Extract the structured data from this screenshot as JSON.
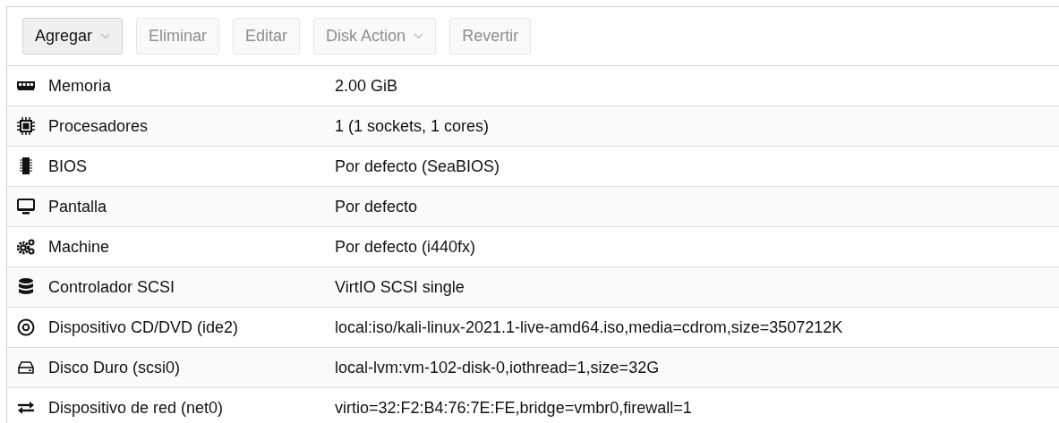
{
  "toolbar": {
    "buttons": [
      {
        "label": "Agregar",
        "disabled": false,
        "dropdown": true
      },
      {
        "label": "Eliminar",
        "disabled": true,
        "dropdown": false
      },
      {
        "label": "Editar",
        "disabled": true,
        "dropdown": false
      },
      {
        "label": "Disk Action",
        "disabled": true,
        "dropdown": true
      },
      {
        "label": "Revertir",
        "disabled": true,
        "dropdown": false
      }
    ]
  },
  "hardware": {
    "rows": [
      {
        "kind": "memory",
        "name": "Memoria",
        "value": "2.00 GiB"
      },
      {
        "kind": "cpu",
        "name": "Procesadores",
        "value": "1 (1 sockets, 1 cores)"
      },
      {
        "kind": "chip",
        "name": "BIOS",
        "value": "Por defecto (SeaBIOS)"
      },
      {
        "kind": "display",
        "name": "Pantalla",
        "value": "Por defecto"
      },
      {
        "kind": "gears",
        "name": "Machine",
        "value": "Por defecto (i440fx)"
      },
      {
        "kind": "database",
        "name": "Controlador SCSI",
        "value": "VirtIO SCSI single"
      },
      {
        "kind": "disc",
        "name": "Dispositivo CD/DVD (ide2)",
        "value": "local:iso/kali-linux-2021.1-live-amd64.iso,media=cdrom,size=3507212K"
      },
      {
        "kind": "harddisk",
        "name": "Disco Duro (scsi0)",
        "value": "local-lvm:vm-102-disk-0,iothread=1,size=32G"
      },
      {
        "kind": "exchange",
        "name": "Dispositivo de red (net0)",
        "value": "virtio=32:F2:B4:76:7E:FE,bridge=vmbr0,firewall=1"
      }
    ]
  }
}
